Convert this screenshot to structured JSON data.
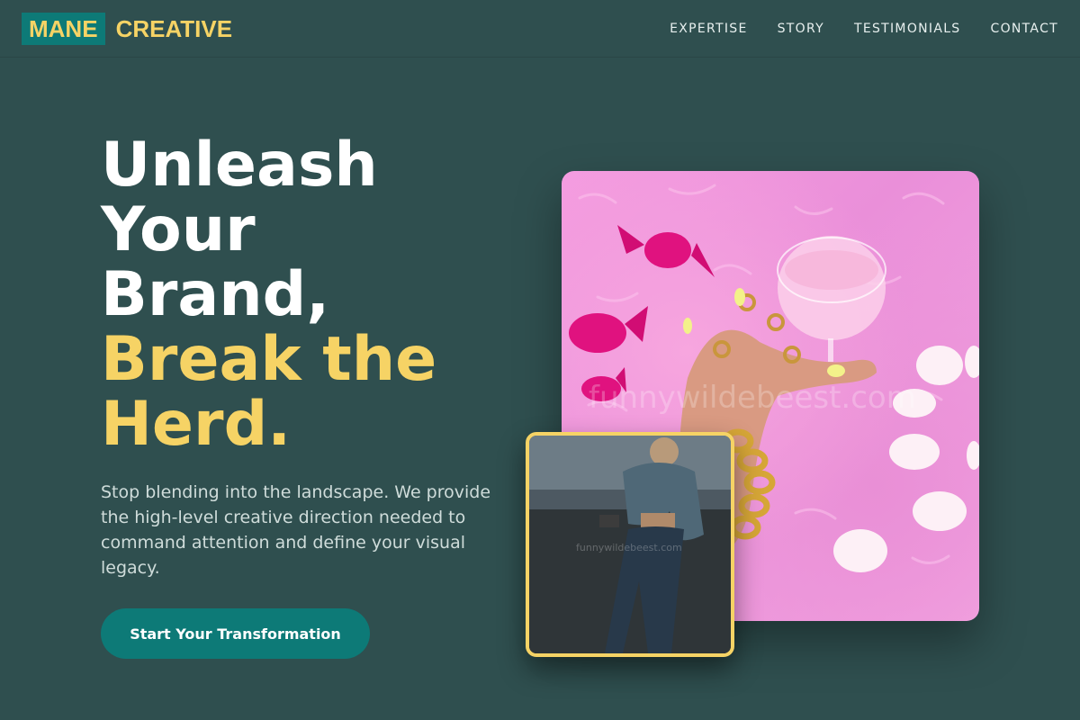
{
  "header": {
    "logo_box": "MANE",
    "logo_text": "CREATIVE",
    "nav": [
      "EXPERTISE",
      "STORY",
      "TESTIMONIALS",
      "CONTACT"
    ]
  },
  "hero": {
    "title_lines": [
      "Unleash",
      "Your",
      "Brand,"
    ],
    "title_accent_lines": [
      "Break the",
      "Herd."
    ],
    "description": "Stop blending into the landscape. We provide the high-level creative direction needed to command attention and define your visual legacy.",
    "cta_label": "Start Your Transformation"
  },
  "images": {
    "main_watermark": "funnywildebeest.com",
    "inset_watermark": "funnywildebeest.com"
  },
  "colors": {
    "background": "#2f4f4f",
    "accent_yellow": "#f6d365",
    "accent_teal": "#0d7a77"
  }
}
